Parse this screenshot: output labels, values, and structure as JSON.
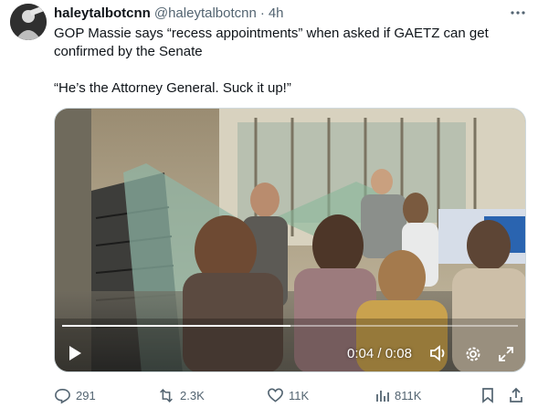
{
  "tweet": {
    "display_name": "haleytalbotcnn",
    "handle": "@haleytalbotcnn",
    "separator": "·",
    "time": "4h",
    "more_icon": "more-horizontal-icon",
    "text_line1": "GOP Massie says “recess appointments” when asked if GAETZ can get confirmed by the Senate",
    "text_line2": "“He’s the Attorney General. Suck it up!”"
  },
  "video": {
    "elapsed": "0:04",
    "time_separator": "/",
    "duration": "0:08",
    "progress_fraction": 0.5,
    "icons": [
      "play-icon",
      "volume-icon",
      "settings-icon",
      "fullscreen-icon"
    ]
  },
  "actions": {
    "replies": "291",
    "reposts": "2.3K",
    "likes": "11K",
    "views": "811K"
  },
  "colors": {
    "text": "#0f1419",
    "secondary": "#536471",
    "border": "#cfd9de"
  }
}
